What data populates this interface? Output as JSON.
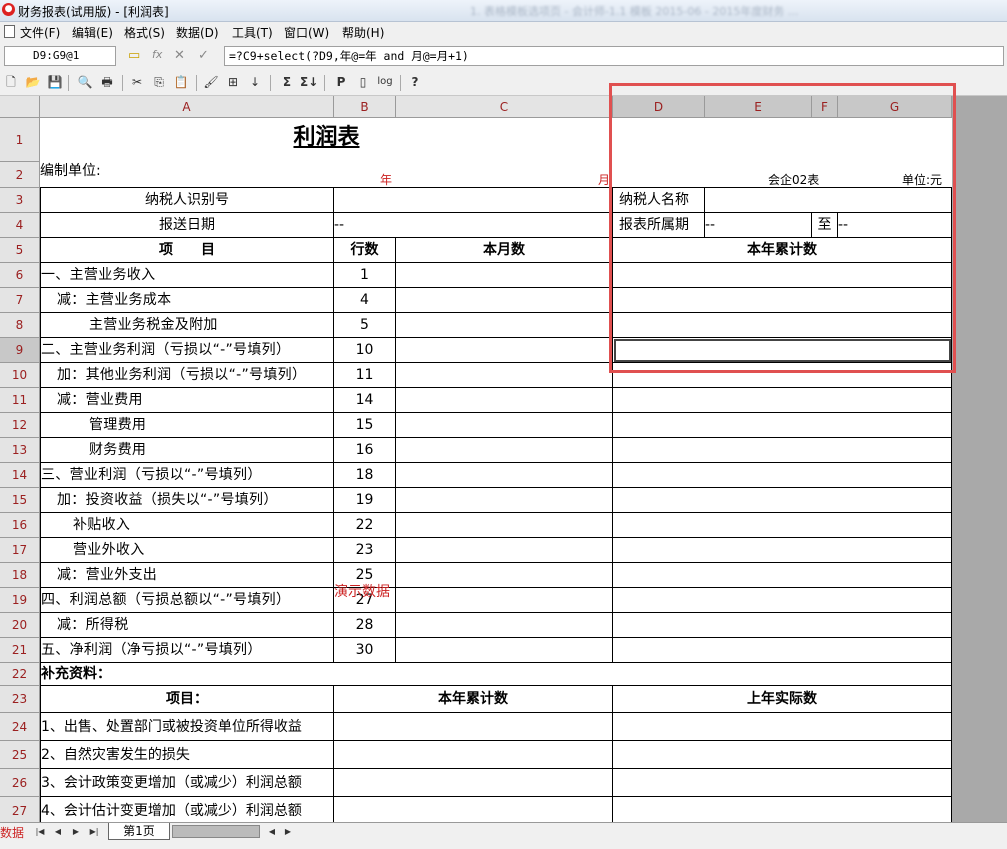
{
  "window": {
    "title": "财务报表(试用版) - [利润表]",
    "blurred_text": "1. 表格模板选项页 - 会计师-1.1 模板  2015-06 - 2015年度财务  ..."
  },
  "menu": [
    "文件(F)",
    "编辑(E)",
    "格式(S)",
    "数据(D)",
    "工具(T)",
    "窗口(W)",
    "帮助(H)"
  ],
  "formula_bar": {
    "cell_ref": "D9:G9@1",
    "formula": "=?C9+select(?D9,年@=年 and 月@=月+1)"
  },
  "toolbar_icons": [
    "new-icon",
    "open-icon",
    "save-icon",
    "print-preview-icon",
    "print-icon",
    "cut-icon",
    "copy-icon",
    "paste-icon",
    "format-painter-icon",
    "insert-icon",
    "sort-icon",
    "sum-icon",
    "sum-sequence-icon",
    "p-icon",
    "page-icon",
    "chart-icon",
    "help-icon"
  ],
  "columns": [
    "A",
    "B",
    "C",
    "D",
    "E",
    "F",
    "G"
  ],
  "rows": [
    "1",
    "2",
    "3",
    "4",
    "5",
    "6",
    "7",
    "8",
    "9",
    "10",
    "11",
    "12",
    "13",
    "14",
    "15",
    "16",
    "17",
    "18",
    "19",
    "20",
    "21",
    "22",
    "23",
    "24",
    "25",
    "26",
    "27"
  ],
  "sheet": {
    "title": "利润表",
    "unit_label": "编制单位:",
    "year_label": "年",
    "month_label": "月",
    "form_code": "会企02表",
    "currency_unit": "单位:元",
    "taxpayer_id_label": "纳税人识别号",
    "taxpayer_name_label": "纳税人名称",
    "submit_date_label": "报送日期",
    "submit_date_value": "--",
    "period_label": "报表所属期",
    "period_from": "--",
    "period_to_label": "至",
    "period_to": "--",
    "header_item": "项　　目",
    "header_line": "行数",
    "header_month": "本月数",
    "header_year": "本年累计数",
    "items": [
      {
        "label": "一、主营业务收入",
        "line": "1",
        "indent": 0
      },
      {
        "label": "减：主营业务成本",
        "line": "4",
        "indent": 1
      },
      {
        "label": "主营业务税金及附加",
        "line": "5",
        "indent": 3
      },
      {
        "label": "二、主营业务利润（亏损以“-”号填列）",
        "line": "10",
        "indent": 0
      },
      {
        "label": "加：其他业务利润（亏损以“-”号填列）",
        "line": "11",
        "indent": 1
      },
      {
        "label": "减：营业费用",
        "line": "14",
        "indent": 1
      },
      {
        "label": "管理费用",
        "line": "15",
        "indent": 3
      },
      {
        "label": "财务费用",
        "line": "16",
        "indent": 3
      },
      {
        "label": "三、营业利润（亏损以“-”号填列）",
        "line": "18",
        "indent": 0
      },
      {
        "label": "加：投资收益（损失以“-”号填列）",
        "line": "19",
        "indent": 1
      },
      {
        "label": "补贴收入",
        "line": "22",
        "indent": 2
      },
      {
        "label": "营业外收入",
        "line": "23",
        "indent": 2
      },
      {
        "label": "减：营业外支出",
        "line": "25",
        "indent": 1
      },
      {
        "label": "四、利润总额（亏损总额以“-”号填列）",
        "line": "27",
        "indent": 0
      },
      {
        "label": "减：所得税",
        "line": "28",
        "indent": 1
      },
      {
        "label": "五、净利润（净亏损以“-”号填列）",
        "line": "30",
        "indent": 0
      }
    ],
    "demo_watermark": "演示数据",
    "supplement_label": "补充资料：",
    "supp_header_item": "项目：",
    "supp_header_current": "本年累计数",
    "supp_header_prior": "上年实际数",
    "supp_items": [
      "1、出售、处置部门或被投资单位所得收益",
      "2、自然灾害发生的损失",
      "3、会计政策变更增加（或减少）利润总额",
      "4、会计估计变更增加（或减少）利润总额"
    ]
  },
  "tabs": {
    "left_label": "数据",
    "sheet_tab": "第1页"
  },
  "colors": {
    "highlight": "#e05050",
    "header_text": "#9b2020",
    "watermark": "#cc2222"
  }
}
